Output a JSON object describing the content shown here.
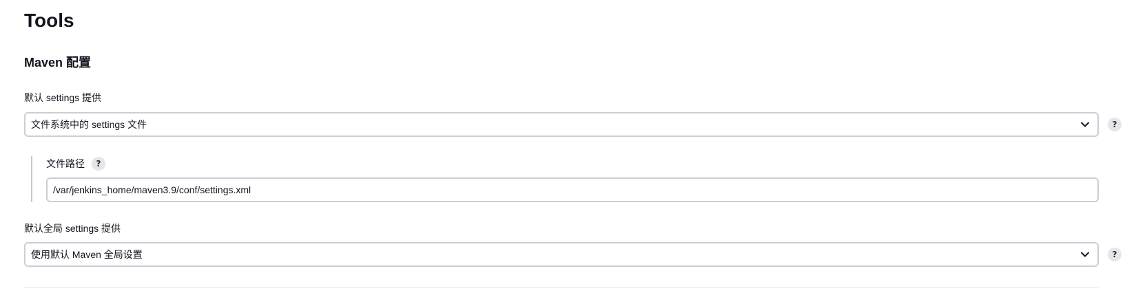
{
  "page": {
    "title": "Tools"
  },
  "maven": {
    "section_title": "Maven 配置",
    "default_settings": {
      "label": "默认 settings 提供",
      "selected": "文件系统中的 settings 文件",
      "help_label": "?"
    },
    "file_path": {
      "label": "文件路径",
      "value": "/var/jenkins_home/maven3.9/conf/settings.xml",
      "help_label": "?"
    },
    "default_global_settings": {
      "label": "默认全局 settings 提供",
      "selected": "使用默认 Maven 全局设置",
      "help_label": "?"
    }
  },
  "icons": {
    "dropdown": "chevron-down-icon",
    "help": "help-icon"
  },
  "colors": {
    "text": "#14141f",
    "border": "#c9cfd6",
    "help_bg": "#e6e6ea",
    "divider": "#e4e4e8"
  }
}
